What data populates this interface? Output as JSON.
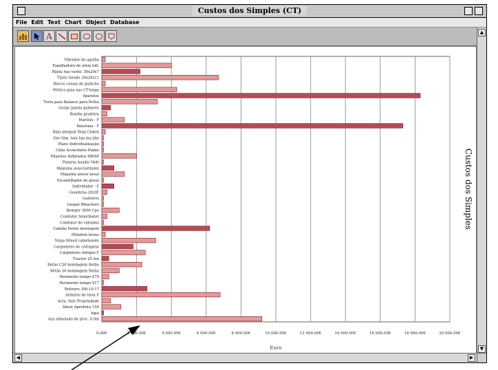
{
  "window": {
    "title": "Custos dos Simples (CT)"
  },
  "menu": [
    "File",
    "Edit",
    "Text",
    "Chart",
    "Object",
    "Database"
  ],
  "toolbar": {
    "tools": [
      {
        "name": "bar-chart-tool",
        "glyph": "▮▮"
      },
      {
        "name": "pointer-tool",
        "glyph": "↖"
      },
      {
        "name": "text-tool",
        "glyph": "A"
      },
      {
        "name": "line-tool",
        "glyph": "╲"
      },
      {
        "name": "rectangle-tool",
        "glyph": "▭"
      },
      {
        "name": "rounded-rect-tool",
        "glyph": "▢"
      },
      {
        "name": "oval-tool",
        "glyph": "◯"
      },
      {
        "name": "polygon-tool",
        "glyph": "⬡"
      }
    ],
    "selected": "pointer-tool"
  },
  "chart_data": {
    "type": "bar",
    "orientation": "horizontal",
    "title": "Custos dos Simples",
    "xlabel": "Euro",
    "ylabel": "",
    "xlim": [
      0,
      20000000
    ],
    "x_ticks": [
      "0.00€",
      "2 000.00€",
      "4 000.00€",
      "6 000.00€",
      "8 000.00€",
      "10 000.00€",
      "12 000.00€",
      "14 000.00€",
      "16 000.00€",
      "18 000.00€",
      "20 000.00€"
    ],
    "grid": true,
    "bar_fill": "#e49a9a",
    "bar_fill_dark": "#b64b55",
    "bar_stroke": "#7a1e28",
    "categories": [
      "Vibrador de agulha",
      "Espalhadora de areia hid.",
      "Rijola 4ao ventil. 30x20x7",
      "Tijolo furado 30x20x11",
      "Blocos canais de guincho",
      "Pórtico guia nas CT-longa",
      "Aparatos",
      "Treta para Balance para PoSta",
      "Gorgo Janela gabinete",
      "Bomba gradeira",
      "Martelo - F",
      "Palestina - F",
      "Bala integral Total Chdoh",
      "Enc-Sim. tam top ma.ldie",
      "Plano Individualização",
      "Chão Aconcheiro Plamo",
      "Pilastres Infiltrados DR/SP",
      "Planeta Auxilio Hidr",
      "Máquina auxo-tarifante",
      "Máquina alveor areal",
      "Escantilhador de gesso",
      "Individador - F",
      "Genebrna 20t/IF",
      "Gaiteiros",
      "Gaspar Bleachers",
      "Bomper 3000 Cpo",
      "Condutor tenerbuder",
      "Condutor de vidrados",
      "Camião Pavilo montagem",
      "Pilindulo bruxo",
      "Ninja Mixed cabellonete",
      "Carpinteiro de cofragens",
      "Carpinteiro Antigos F",
      "Tractor 25 ton",
      "Betão C20 bombagem Betão",
      "Betão 30 bombagem Betão",
      "Pavimento tempo S70",
      "Pavimento tempo S17",
      "Retiraro 300-10-17",
      "Armário de tinta F",
      "Acta, Vale Propriedade",
      "Sheet Aperfeira 150",
      "Aqui",
      "Aço Aduelado de proc. 6.9m"
    ],
    "values": [
      200000,
      4000000,
      2200000,
      6700000,
      200000,
      4300000,
      18300000,
      3200000,
      500000,
      300000,
      1300000,
      17300000,
      200000,
      100000,
      100000,
      100000,
      2000000,
      100000,
      700000,
      1300000,
      100000,
      700000,
      300000,
      100000,
      100000,
      1000000,
      300000,
      100000,
      6200000,
      200000,
      3100000,
      1800000,
      2500000,
      400000,
      2300000,
      1000000,
      400000,
      100000,
      2600000,
      6800000,
      500000,
      1100000,
      100000,
      9200000
    ],
    "dark_pattern": [
      false,
      false,
      true,
      false,
      false,
      false,
      true,
      false,
      true,
      false,
      false,
      true,
      false,
      false,
      false,
      false,
      false,
      false,
      true,
      false,
      false,
      true,
      false,
      false,
      false,
      false,
      false,
      false,
      true,
      false,
      false,
      true,
      false,
      true,
      false,
      false,
      false,
      false,
      true,
      false,
      false,
      false,
      true,
      false
    ]
  }
}
